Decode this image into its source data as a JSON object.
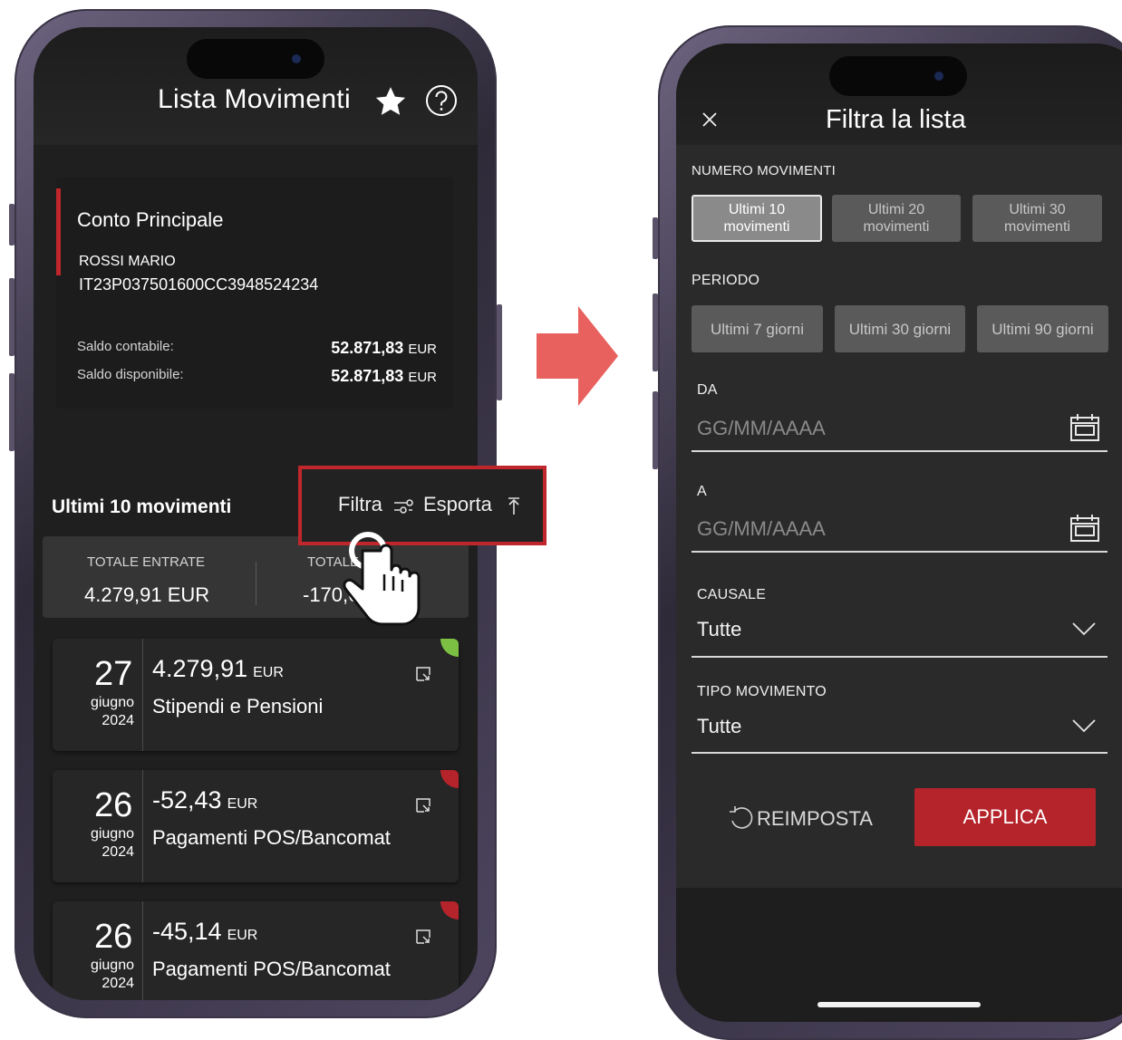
{
  "left": {
    "title": "Lista Movimenti",
    "account": {
      "name": "Conto Principale",
      "holder": "ROSSI MARIO",
      "iban": "IT23P037501600CC3948524234",
      "saldo_contabile_label": "Saldo contabile:",
      "saldo_contabile_value": "52.871,83",
      "saldo_disponibile_label": "Saldo disponibile:",
      "saldo_disponibile_value": "52.871,83",
      "currency": "EUR"
    },
    "movements_title": "Ultimi 10 movimenti",
    "filter_label": "Filtra",
    "export_label": "Esporta",
    "totals": {
      "in_label": "TOTALE ENTRATE",
      "in_value": "4.279,91 EUR",
      "out_label": "TOTALE",
      "out_value": "-170,6"
    },
    "movements": [
      {
        "day": "27",
        "month": "giugno",
        "year": "2024",
        "amount": "4.279,91",
        "currency": "EUR",
        "description": "Stipendi e Pensioni",
        "type": "in"
      },
      {
        "day": "26",
        "month": "giugno",
        "year": "2024",
        "amount": "-52,43",
        "currency": "EUR",
        "description": "Pagamenti POS/Bancomat",
        "type": "out"
      },
      {
        "day": "26",
        "month": "giugno",
        "year": "2024",
        "amount": "-45,14",
        "currency": "EUR",
        "description": "Pagamenti POS/Bancomat",
        "type": "out"
      }
    ]
  },
  "right": {
    "title": "Filtra la lista",
    "numero_label": "NUMERO MOVIMENTI",
    "numero_options": [
      {
        "line1": "Ultimi 10",
        "line2": "movimenti",
        "active": true
      },
      {
        "line1": "Ultimi 20",
        "line2": "movimenti",
        "active": false
      },
      {
        "line1": "Ultimi 30",
        "line2": "movimenti",
        "active": false
      }
    ],
    "periodo_label": "PERIODO",
    "periodo_options": [
      "Ultimi 7 giorni",
      "Ultimi 30 giorni",
      "Ultimi 90 giorni"
    ],
    "da_label": "DA",
    "da_placeholder": "GG/MM/AAAA",
    "a_label": "A",
    "a_placeholder": "GG/MM/AAAA",
    "causale_label": "CAUSALE",
    "causale_value": "Tutte",
    "tipo_label": "TIPO MOVIMENTO",
    "tipo_value": "Tutte",
    "reset_label": "REIMPOSTA",
    "apply_label": "APPLICA"
  },
  "colors": {
    "accent_red": "#c0272d",
    "apply_red": "#b5232b",
    "arrow": "#e8615e",
    "income_green": "#7bc043"
  },
  "icons": [
    "star-icon",
    "help-icon",
    "filter-icon",
    "export-icon",
    "expand-icon",
    "hand-pointer-icon",
    "arrow-right-icon",
    "close-icon",
    "calendar-icon",
    "chevron-down-icon",
    "reset-icon"
  ]
}
